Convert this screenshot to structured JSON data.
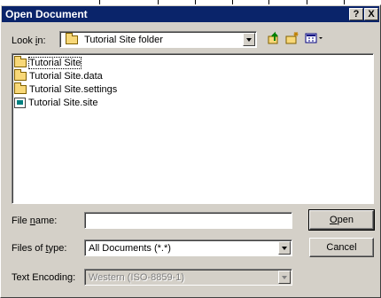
{
  "dialog": {
    "title": "Open Document",
    "help_button": "?",
    "close_button": "X"
  },
  "look_in": {
    "label_pre": "Look ",
    "label_key": "i",
    "label_post": "n:",
    "selected_value": "Tutorial Site folder"
  },
  "toolbar": {
    "up_icon": "up-folder-icon",
    "new_folder_icon": "new-folder-icon",
    "view_menu_icon": "view-menu-icon"
  },
  "files": [
    {
      "name": "Tutorial Site",
      "icon": "folder-icon",
      "selected": true
    },
    {
      "name": "Tutorial Site.data",
      "icon": "folder-icon",
      "selected": false
    },
    {
      "name": "Tutorial Site.settings",
      "icon": "folder-icon",
      "selected": false
    },
    {
      "name": "Tutorial Site.site",
      "icon": "site-file-icon",
      "selected": false
    }
  ],
  "file_name": {
    "label_pre": "File ",
    "label_key": "n",
    "label_post": "ame:",
    "value": ""
  },
  "files_of_type": {
    "label_pre": "Files of ",
    "label_key": "t",
    "label_post": "ype:",
    "selected_value": "All Documents (*.*)"
  },
  "text_encoding": {
    "label": "Text Encoding:",
    "selected_value": "Western (ISO-8859-1)"
  },
  "buttons": {
    "open_key": "O",
    "open_rest": "pen",
    "cancel": "Cancel"
  },
  "colors": {
    "titlebar": "#0a246a",
    "dialog_face": "#d4d0c8"
  }
}
